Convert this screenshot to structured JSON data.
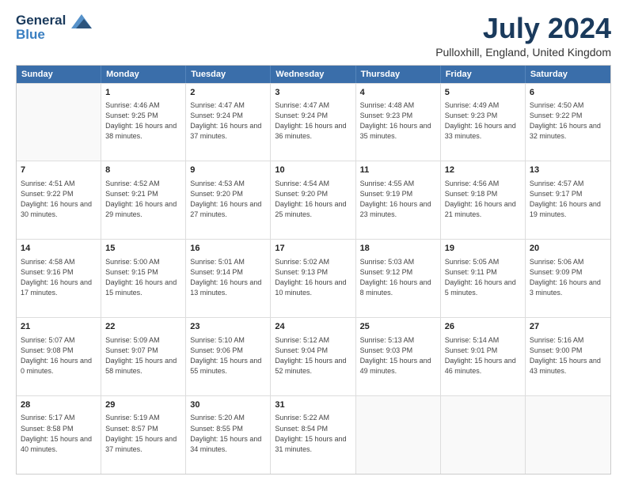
{
  "logo": {
    "line1": "General",
    "line2": "Blue"
  },
  "title": "July 2024",
  "location": "Pulloxhill, England, United Kingdom",
  "days_of_week": [
    "Sunday",
    "Monday",
    "Tuesday",
    "Wednesday",
    "Thursday",
    "Friday",
    "Saturday"
  ],
  "weeks": [
    [
      {
        "day": "",
        "info": ""
      },
      {
        "day": "1",
        "sunrise": "Sunrise: 4:46 AM",
        "sunset": "Sunset: 9:25 PM",
        "daylight": "Daylight: 16 hours and 38 minutes."
      },
      {
        "day": "2",
        "sunrise": "Sunrise: 4:47 AM",
        "sunset": "Sunset: 9:24 PM",
        "daylight": "Daylight: 16 hours and 37 minutes."
      },
      {
        "day": "3",
        "sunrise": "Sunrise: 4:47 AM",
        "sunset": "Sunset: 9:24 PM",
        "daylight": "Daylight: 16 hours and 36 minutes."
      },
      {
        "day": "4",
        "sunrise": "Sunrise: 4:48 AM",
        "sunset": "Sunset: 9:23 PM",
        "daylight": "Daylight: 16 hours and 35 minutes."
      },
      {
        "day": "5",
        "sunrise": "Sunrise: 4:49 AM",
        "sunset": "Sunset: 9:23 PM",
        "daylight": "Daylight: 16 hours and 33 minutes."
      },
      {
        "day": "6",
        "sunrise": "Sunrise: 4:50 AM",
        "sunset": "Sunset: 9:22 PM",
        "daylight": "Daylight: 16 hours and 32 minutes."
      }
    ],
    [
      {
        "day": "7",
        "sunrise": "Sunrise: 4:51 AM",
        "sunset": "Sunset: 9:22 PM",
        "daylight": "Daylight: 16 hours and 30 minutes."
      },
      {
        "day": "8",
        "sunrise": "Sunrise: 4:52 AM",
        "sunset": "Sunset: 9:21 PM",
        "daylight": "Daylight: 16 hours and 29 minutes."
      },
      {
        "day": "9",
        "sunrise": "Sunrise: 4:53 AM",
        "sunset": "Sunset: 9:20 PM",
        "daylight": "Daylight: 16 hours and 27 minutes."
      },
      {
        "day": "10",
        "sunrise": "Sunrise: 4:54 AM",
        "sunset": "Sunset: 9:20 PM",
        "daylight": "Daylight: 16 hours and 25 minutes."
      },
      {
        "day": "11",
        "sunrise": "Sunrise: 4:55 AM",
        "sunset": "Sunset: 9:19 PM",
        "daylight": "Daylight: 16 hours and 23 minutes."
      },
      {
        "day": "12",
        "sunrise": "Sunrise: 4:56 AM",
        "sunset": "Sunset: 9:18 PM",
        "daylight": "Daylight: 16 hours and 21 minutes."
      },
      {
        "day": "13",
        "sunrise": "Sunrise: 4:57 AM",
        "sunset": "Sunset: 9:17 PM",
        "daylight": "Daylight: 16 hours and 19 minutes."
      }
    ],
    [
      {
        "day": "14",
        "sunrise": "Sunrise: 4:58 AM",
        "sunset": "Sunset: 9:16 PM",
        "daylight": "Daylight: 16 hours and 17 minutes."
      },
      {
        "day": "15",
        "sunrise": "Sunrise: 5:00 AM",
        "sunset": "Sunset: 9:15 PM",
        "daylight": "Daylight: 16 hours and 15 minutes."
      },
      {
        "day": "16",
        "sunrise": "Sunrise: 5:01 AM",
        "sunset": "Sunset: 9:14 PM",
        "daylight": "Daylight: 16 hours and 13 minutes."
      },
      {
        "day": "17",
        "sunrise": "Sunrise: 5:02 AM",
        "sunset": "Sunset: 9:13 PM",
        "daylight": "Daylight: 16 hours and 10 minutes."
      },
      {
        "day": "18",
        "sunrise": "Sunrise: 5:03 AM",
        "sunset": "Sunset: 9:12 PM",
        "daylight": "Daylight: 16 hours and 8 minutes."
      },
      {
        "day": "19",
        "sunrise": "Sunrise: 5:05 AM",
        "sunset": "Sunset: 9:11 PM",
        "daylight": "Daylight: 16 hours and 5 minutes."
      },
      {
        "day": "20",
        "sunrise": "Sunrise: 5:06 AM",
        "sunset": "Sunset: 9:09 PM",
        "daylight": "Daylight: 16 hours and 3 minutes."
      }
    ],
    [
      {
        "day": "21",
        "sunrise": "Sunrise: 5:07 AM",
        "sunset": "Sunset: 9:08 PM",
        "daylight": "Daylight: 16 hours and 0 minutes."
      },
      {
        "day": "22",
        "sunrise": "Sunrise: 5:09 AM",
        "sunset": "Sunset: 9:07 PM",
        "daylight": "Daylight: 15 hours and 58 minutes."
      },
      {
        "day": "23",
        "sunrise": "Sunrise: 5:10 AM",
        "sunset": "Sunset: 9:06 PM",
        "daylight": "Daylight: 15 hours and 55 minutes."
      },
      {
        "day": "24",
        "sunrise": "Sunrise: 5:12 AM",
        "sunset": "Sunset: 9:04 PM",
        "daylight": "Daylight: 15 hours and 52 minutes."
      },
      {
        "day": "25",
        "sunrise": "Sunrise: 5:13 AM",
        "sunset": "Sunset: 9:03 PM",
        "daylight": "Daylight: 15 hours and 49 minutes."
      },
      {
        "day": "26",
        "sunrise": "Sunrise: 5:14 AM",
        "sunset": "Sunset: 9:01 PM",
        "daylight": "Daylight: 15 hours and 46 minutes."
      },
      {
        "day": "27",
        "sunrise": "Sunrise: 5:16 AM",
        "sunset": "Sunset: 9:00 PM",
        "daylight": "Daylight: 15 hours and 43 minutes."
      }
    ],
    [
      {
        "day": "28",
        "sunrise": "Sunrise: 5:17 AM",
        "sunset": "Sunset: 8:58 PM",
        "daylight": "Daylight: 15 hours and 40 minutes."
      },
      {
        "day": "29",
        "sunrise": "Sunrise: 5:19 AM",
        "sunset": "Sunset: 8:57 PM",
        "daylight": "Daylight: 15 hours and 37 minutes."
      },
      {
        "day": "30",
        "sunrise": "Sunrise: 5:20 AM",
        "sunset": "Sunset: 8:55 PM",
        "daylight": "Daylight: 15 hours and 34 minutes."
      },
      {
        "day": "31",
        "sunrise": "Sunrise: 5:22 AM",
        "sunset": "Sunset: 8:54 PM",
        "daylight": "Daylight: 15 hours and 31 minutes."
      },
      {
        "day": "",
        "info": ""
      },
      {
        "day": "",
        "info": ""
      },
      {
        "day": "",
        "info": ""
      }
    ]
  ]
}
